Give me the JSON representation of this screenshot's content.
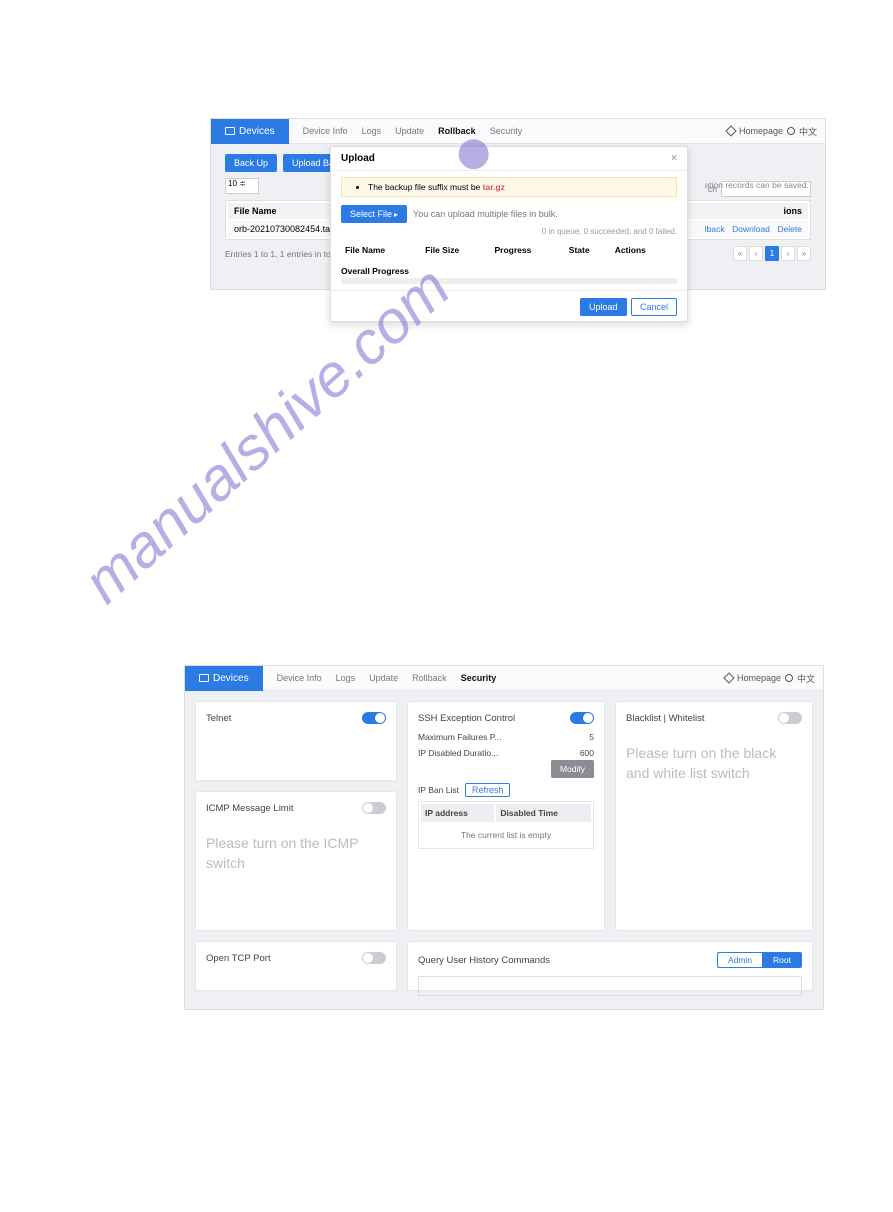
{
  "shot1": {
    "nav": {
      "devices": "Devices",
      "items": [
        "Device Info",
        "Logs",
        "Update",
        "Rollback",
        "Security"
      ],
      "active": "Rollback"
    },
    "topright": {
      "home": "Homepage",
      "lang": "中文"
    },
    "body": {
      "backup_btn": "Back Up",
      "upload_btn": "Upload Backup",
      "note_right": "ation records can be saved.",
      "pagesize": "10 ≑",
      "search_label": "ch",
      "col_file": "File Name",
      "col_actions": "ions",
      "row_file": "orb-20210730082454.tar.gz",
      "action_back": "lback",
      "action_download": "Download",
      "action_delete": "Delete",
      "footer": "Entries 1 to 1, 1 entries in to"
    },
    "modal": {
      "title": "Upload",
      "close": "×",
      "alert_prefix": "The backup file suffix must be ",
      "alert_suffix": "tar.gz",
      "select_file": "Select File",
      "bulk_hint": "You can upload multiple files in bulk.",
      "status": "0 in queue, 0 succeeded, and 0 failed.",
      "cols": {
        "name": "File Name",
        "size": "File Size",
        "progress": "Progress",
        "state": "State",
        "actions": "Actions"
      },
      "overall": "Overall Progress",
      "upload_btn": "Upload",
      "cancel_btn": "Cancel"
    }
  },
  "shot2": {
    "nav": {
      "devices": "Devices",
      "items": [
        "Device Info",
        "Logs",
        "Update",
        "Rollback",
        "Security"
      ],
      "active": "Security"
    },
    "topright": {
      "home": "Homepage",
      "lang": "中文"
    },
    "telnet": {
      "title": "Telnet"
    },
    "icmp": {
      "title": "ICMP Message Limit",
      "msg": "Please turn on the ICMP switch"
    },
    "ssh": {
      "title": "SSH Exception Control",
      "max_label": "Maximum Failures P...",
      "max_val": "5",
      "dur_label": "IP Disabled Duratio...",
      "dur_val": "600",
      "modify": "Modify",
      "banlist": "IP Ban List",
      "refresh": "Refresh",
      "col_ip": "IP address",
      "col_time": "Disabled Time",
      "empty": "The current list is empty"
    },
    "bw": {
      "title": "Blacklist | Whitelist",
      "msg": "Please turn on the black and white list switch"
    },
    "tcp": {
      "title": "Open TCP Port"
    },
    "query": {
      "title": "Query User History Commands",
      "admin": "Admin",
      "root": "Root"
    }
  },
  "watermark": "manualshive.com"
}
